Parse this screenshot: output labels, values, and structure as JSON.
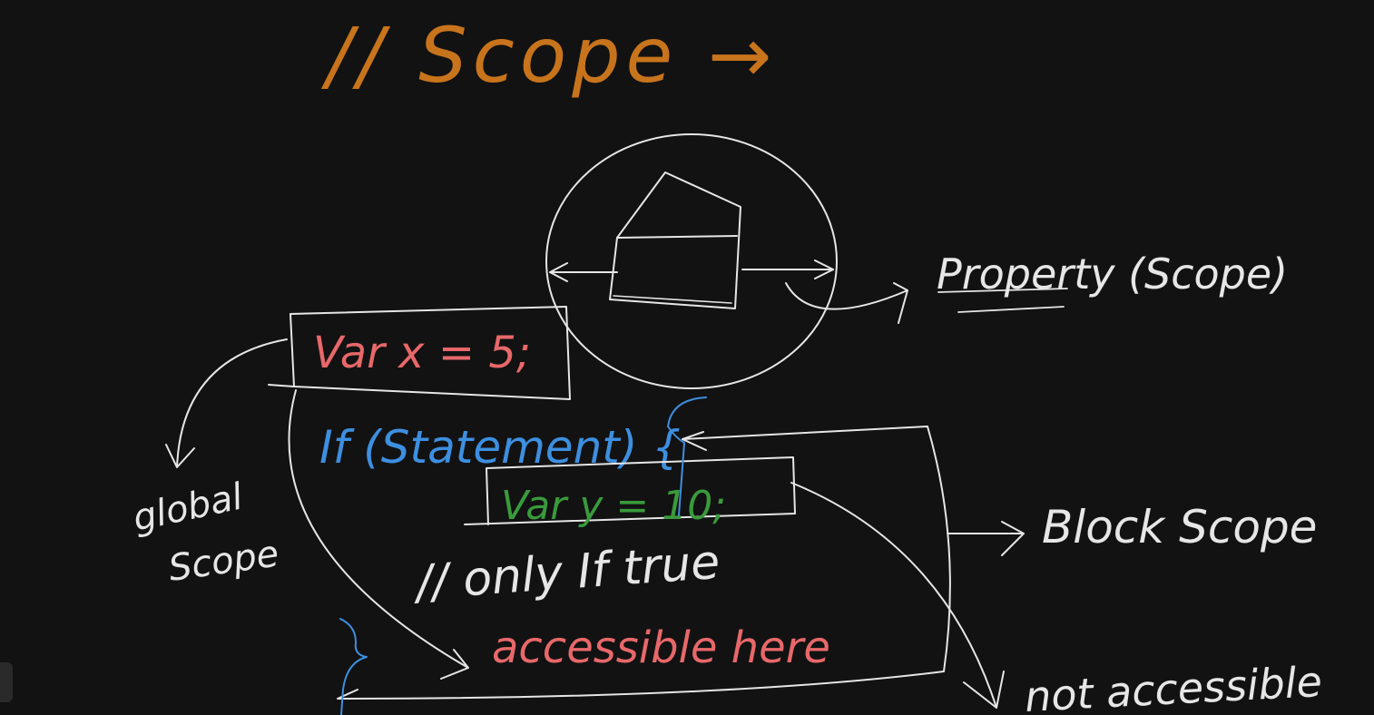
{
  "colors": {
    "background": "#121212",
    "chalk": "#e6e6e6",
    "orange": "#c8741c",
    "red": "#e8686a",
    "blue": "#3d8fe0",
    "green": "#3a9a3c"
  },
  "title": "// Scope →",
  "diagram": {
    "property_label": "Property (Scope)",
    "var_x": "Var x = 5;",
    "global_scope_line1": "global",
    "global_scope_line2": "Scope",
    "if_statement": "If (Statement) {",
    "var_y": "Var y = 10;",
    "only_if_true": "// only If true",
    "accessible_here": "accessible here",
    "block_scope": "Block Scope",
    "not_accessible": "not accessible"
  },
  "ui": {
    "side_tab_icon": "panel-handle-icon"
  }
}
